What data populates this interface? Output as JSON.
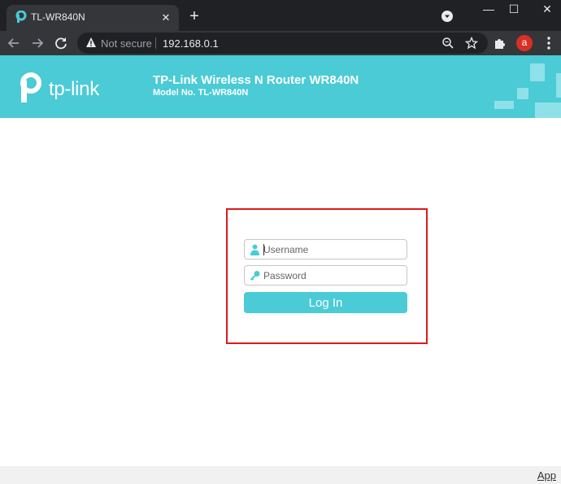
{
  "browser": {
    "tab": {
      "title": "TL-WR840N",
      "close_glyph": "✕"
    },
    "new_tab_glyph": "+",
    "window_controls": {
      "minimize": "—",
      "maximize": "☐",
      "close": "✕"
    },
    "omnibox": {
      "security_label": "Not secure",
      "url": "192.168.0.1"
    },
    "profile_initial": "a",
    "icons": [
      "tp-link-favicon-icon",
      "tab-search-icon",
      "back-arrow-icon",
      "forward-arrow-icon",
      "reload-icon",
      "warning-icon",
      "zoom-icon",
      "bookmark-star-icon",
      "extensions-puzzle-icon",
      "kebab-menu-icon"
    ]
  },
  "header": {
    "logo_text": "tp-link",
    "title": "TP-Link Wireless N Router WR840N",
    "model": "Model No. TL-WR840N"
  },
  "login": {
    "username_placeholder": "Username",
    "password_placeholder": "Password",
    "button_label": "Log In"
  },
  "footer": {
    "app_link": "App"
  },
  "colors": {
    "accent": "#4acbd6",
    "highlight_frame": "#e0191b",
    "chrome_dark": "#202124",
    "chrome_toolbar": "#35363a"
  }
}
